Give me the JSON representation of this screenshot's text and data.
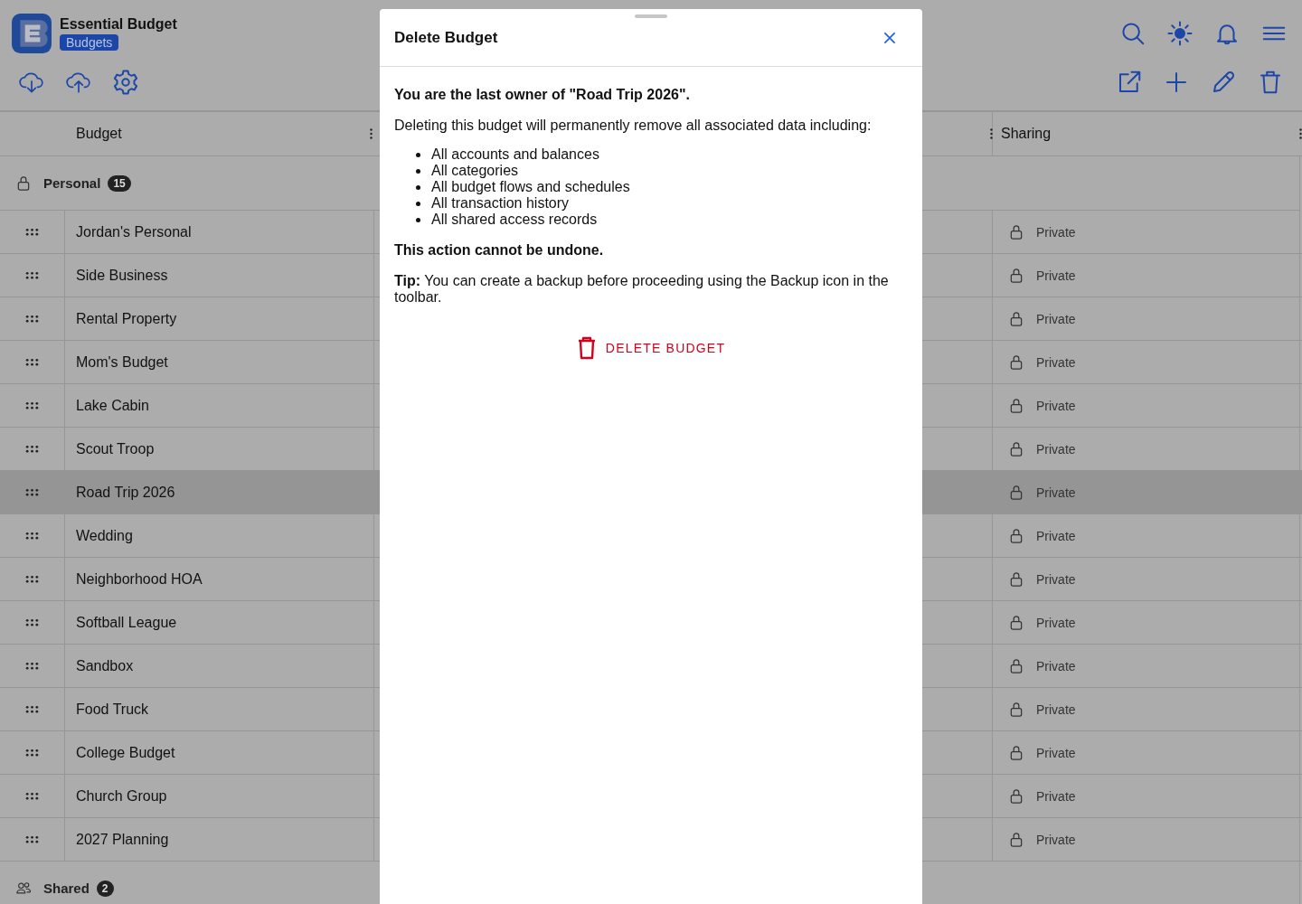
{
  "app": {
    "name": "Essential Budget",
    "section": "Budgets"
  },
  "table": {
    "columns": [
      "Budget",
      "Sharing"
    ],
    "groups": [
      {
        "label": "Personal",
        "count": "15",
        "kind": "private",
        "rows": [
          {
            "name": "Jordan's Personal",
            "sharing": "Private",
            "selected": false
          },
          {
            "name": "Side Business",
            "sharing": "Private",
            "selected": false
          },
          {
            "name": "Rental Property",
            "sharing": "Private",
            "selected": false
          },
          {
            "name": "Mom's Budget",
            "sharing": "Private",
            "selected": false
          },
          {
            "name": "Lake Cabin",
            "sharing": "Private",
            "selected": false
          },
          {
            "name": "Scout Troop",
            "sharing": "Private",
            "selected": false
          },
          {
            "name": "Road Trip 2026",
            "sharing": "Private",
            "selected": true
          },
          {
            "name": "Wedding",
            "sharing": "Private",
            "selected": false
          },
          {
            "name": "Neighborhood HOA",
            "sharing": "Private",
            "selected": false
          },
          {
            "name": "Softball League",
            "sharing": "Private",
            "selected": false
          },
          {
            "name": "Sandbox",
            "sharing": "Private",
            "selected": false
          },
          {
            "name": "Food Truck",
            "sharing": "Private",
            "selected": false
          },
          {
            "name": "College Budget",
            "sharing": "Private",
            "selected": false
          },
          {
            "name": "Church Group",
            "sharing": "Private",
            "selected": false
          },
          {
            "name": "2027 Planning",
            "sharing": "Private",
            "selected": false
          }
        ]
      },
      {
        "label": "Shared",
        "count": "2",
        "kind": "shared"
      }
    ]
  },
  "dialog": {
    "title": "Delete Budget",
    "heading": "You are the last owner of \"Road Trip 2026\".",
    "intro": "Deleting this budget will permanently remove all associated data including:",
    "items": [
      "All accounts and balances",
      "All categories",
      "All budget flows and schedules",
      "All transaction history",
      "All shared access records"
    ],
    "warning": "This action cannot be undone.",
    "tip": "**Tip:** You can create a backup before proceeding using the Backup icon in the toolbar.",
    "button": "DELETE BUDGET"
  }
}
